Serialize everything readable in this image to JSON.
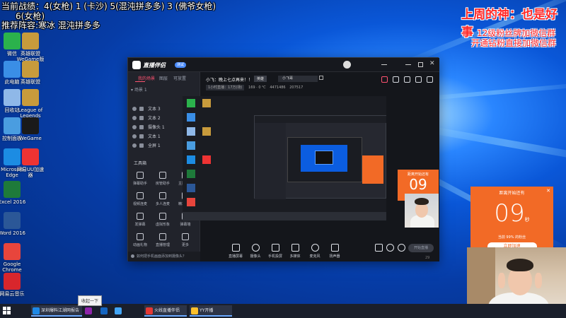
{
  "overlay": {
    "line1": "当前战绩：4(女枪) 1 (卡沙) 5(混沌拼多多) 3 (佛爷女枪)",
    "line2": "6(女枪)",
    "line3": "推荐阵容:寒冰 混沌拼多多",
    "title_right": "上周的神：也是好事",
    "promo1": "12级粉丝牌加微信群",
    "promo2": "开通钻粉直接加微信群"
  },
  "desktop_icons": [
    {
      "label": "微信",
      "color": "#2bb24c"
    },
    {
      "label": "英雄联盟WeGame版",
      "color": "#c89b3c"
    },
    {
      "label": "此电脑",
      "color": "#3a8ee6"
    },
    {
      "label": "英雄联盟",
      "color": "#c89b3c"
    },
    {
      "label": "回收站",
      "color": "#8fb8e8"
    },
    {
      "label": "League of Legends",
      "color": "#c89b3c"
    },
    {
      "label": "控制面板",
      "color": "#4a9de0"
    },
    {
      "label": "WeGame",
      "color": "#1a1a1a"
    },
    {
      "label": "Microsoft Edge",
      "color": "#1c8ce3"
    },
    {
      "label": "网易UU加速器",
      "color": "#e33"
    },
    {
      "label": "Excel 2016",
      "color": "#1e7a3a"
    },
    {
      "label": "Word 2016",
      "color": "#2b5797"
    },
    {
      "label": "Google Chrome",
      "color": "#e8453c"
    },
    {
      "label": "网易云音乐",
      "color": "#d8262c"
    }
  ],
  "app": {
    "name": "直播伴侣",
    "badge": "测试",
    "tabs": [
      "我的场景",
      "图层",
      "可放置"
    ],
    "scene_header": "场景 1",
    "layers": [
      "文本 3",
      "文本 2",
      "摄像头 1",
      "文本 1",
      "全屏 1"
    ],
    "toolbox_title": "工具箱",
    "tools": [
      [
        "弹幕助手",
        "房管助手",
        "主播日历"
      ],
      [
        "视频连麦",
        "多人连麦",
        "精华剪辑"
      ],
      [
        "发弹幕",
        "虚拟形象",
        "弹幕墙"
      ],
      [
        "动画礼物",
        "直播管理",
        "更多"
      ]
    ],
    "stream_title": "小飞：晚上七点再来！！",
    "stream_tag": "英雄",
    "stream_input": "小飞哥",
    "stats": [
      "1小时直播：17万(场)",
      "169 · 0 ℃",
      "4471486",
      "207517"
    ],
    "controls": [
      "直播屏幕",
      "摄像头",
      "手机投屏",
      "多媒体",
      "麦克风",
      "扬声器"
    ],
    "start_button": "开始直播",
    "tip_text": "如何把手机画面添加到摄像头？",
    "version": "29"
  },
  "timers": {
    "small_label": "距离开始还有",
    "big_label": "距离开始还有",
    "big_digits": "09",
    "big_unit": "秒",
    "big_sub": "当前 99% 的粉丝",
    "big_button": "立即加速",
    "small_digits": "09"
  },
  "taskbar": {
    "items": [
      {
        "label": "深圳爆料江湖网报告",
        "color": "#1e88e5"
      },
      {
        "label": "",
        "color": "#8e24aa"
      },
      {
        "label": "",
        "color": "#1565c0"
      },
      {
        "label": "",
        "color": "#42a5f5"
      },
      {
        "label": "火线直播伴侣",
        "color": "#e53935"
      },
      {
        "label": "YY开播",
        "color": "#fbc02d"
      }
    ],
    "popup": "收起一下"
  }
}
